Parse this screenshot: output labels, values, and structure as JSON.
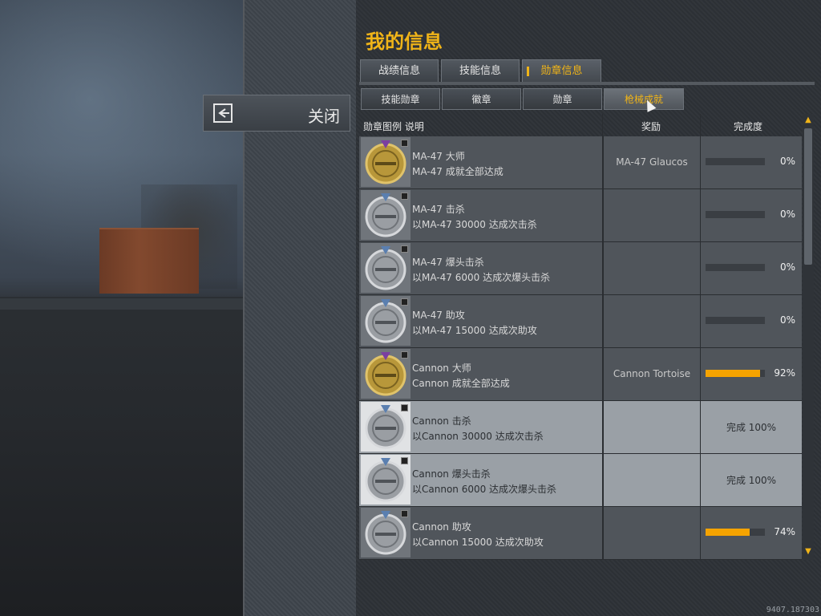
{
  "window": {
    "title": "我的信息"
  },
  "close": {
    "label": "关闭",
    "icon": "exit-icon"
  },
  "tabs": [
    {
      "label": "战绩信息",
      "active": false
    },
    {
      "label": "技能信息",
      "active": false
    },
    {
      "label": "勋章信息",
      "active": true
    }
  ],
  "subtabs": [
    {
      "label": "技能勋章",
      "active": false
    },
    {
      "label": "徽章",
      "active": false
    },
    {
      "label": "勋章",
      "active": false
    },
    {
      "label": "枪械成就",
      "active": true
    }
  ],
  "table": {
    "headers": {
      "medal_desc": "勋章图例 说明",
      "reward": "奖励",
      "completion": "完成度"
    },
    "rows": [
      {
        "name": "MA-47 大师",
        "desc": "MA-47 成就全部达成",
        "reward": "MA-47 Glaucos",
        "progress": 0,
        "pct": "0%",
        "done": false,
        "medal": "gold-medal-icon"
      },
      {
        "name": "MA-47 击杀",
        "desc": "以MA-47 30000 达成次击杀",
        "reward": "",
        "progress": 0,
        "pct": "0%",
        "done": false,
        "medal": "silver-medal-icon"
      },
      {
        "name": "MA-47 爆头击杀",
        "desc": "以MA-47 6000 达成次爆头击杀",
        "reward": "",
        "progress": 0,
        "pct": "0%",
        "done": false,
        "medal": "silver-medal-icon"
      },
      {
        "name": "MA-47 助攻",
        "desc": "以MA-47 15000 达成次助攻",
        "reward": "",
        "progress": 0,
        "pct": "0%",
        "done": false,
        "medal": "silver-medal-icon"
      },
      {
        "name": "Cannon 大师",
        "desc": "Cannon 成就全部达成",
        "reward": "Cannon Tortoise",
        "progress": 92,
        "pct": "92%",
        "done": false,
        "medal": "gold-medal-icon"
      },
      {
        "name": "Cannon 击杀",
        "desc": "以Cannon 30000 达成次击杀",
        "reward": "",
        "progress": 100,
        "pct": "完成 100%",
        "done": true,
        "medal": "silver-medal-icon"
      },
      {
        "name": "Cannon 爆头击杀",
        "desc": "以Cannon 6000 达成次爆头击杀",
        "reward": "",
        "progress": 100,
        "pct": "完成 100%",
        "done": true,
        "medal": "silver-medal-icon"
      },
      {
        "name": "Cannon 助攻",
        "desc": "以Cannon 15000 达成次助攻",
        "reward": "",
        "progress": 74,
        "pct": "74%",
        "done": false,
        "medal": "silver-medal-icon"
      }
    ]
  },
  "footer": {
    "build": "9407.187303"
  },
  "colors": {
    "accent": "#f0b418",
    "progress": "#f5a300"
  }
}
